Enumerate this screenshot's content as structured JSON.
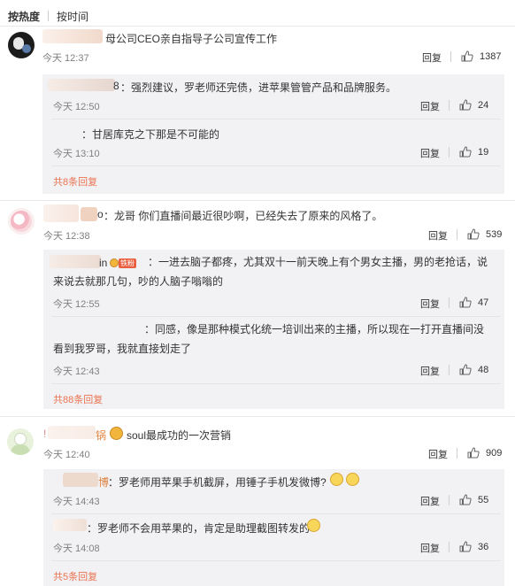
{
  "sort": {
    "hot": "按热度",
    "time": "按时间"
  },
  "comments": [
    {
      "text": "母公司CEO亲自指导子公司宣传工作",
      "time": "今天 12:37",
      "reply": "回复",
      "likes": "1387",
      "replies": [
        {
          "name_tail": "8",
          "text": "：强烈建议，罗老师还完债，进苹果管管产品和品牌服务。",
          "time": "今天 12:50",
          "reply": "回复",
          "likes": "24"
        },
        {
          "text": "：甘居库克之下那是不可能的",
          "time": "今天 13:10",
          "reply": "回复",
          "likes": "19"
        }
      ],
      "more": "共8条回复"
    },
    {
      "name_tail": "o",
      "text": "：龙哥 你们直播间最近很吵啊，已经失去了原来的风格了。",
      "time": "今天 12:38",
      "reply": "回复",
      "likes": "539",
      "replies": [
        {
          "name_tail": "in",
          "badge": "铁粉",
          "text": "：一进去脑子都疼，尤其双十一前天晚上有个男女主播，男的老抢话，说来说去就那几句，吵的人脑子嗡嗡的",
          "time": "今天 12:55",
          "reply": "回复",
          "likes": "47"
        },
        {
          "text": "：同感，像是那种模式化统一培训出来的主播，所以现在一打开直播间没看到我罗哥，我就直接划走了",
          "time": "今天 12:43",
          "reply": "回复",
          "likes": "48"
        }
      ],
      "more": "共88条回复"
    },
    {
      "name_head": "!",
      "name_tail": "锅",
      "text": "soul最成功的一次营销",
      "time": "今天 12:40",
      "reply": "回复",
      "likes": "909",
      "replies": [
        {
          "name_tail": "博",
          "text": "：罗老师用苹果手机截屏，用锤子手机发微博?",
          "time": "今天 14:43",
          "reply": "回复",
          "likes": "55"
        },
        {
          "text": "：罗老师不会用苹果的，肯定是助理截图转发的",
          "time": "今天 14:08",
          "reply": "回复",
          "likes": "36"
        }
      ],
      "more": "共5条回复"
    }
  ]
}
